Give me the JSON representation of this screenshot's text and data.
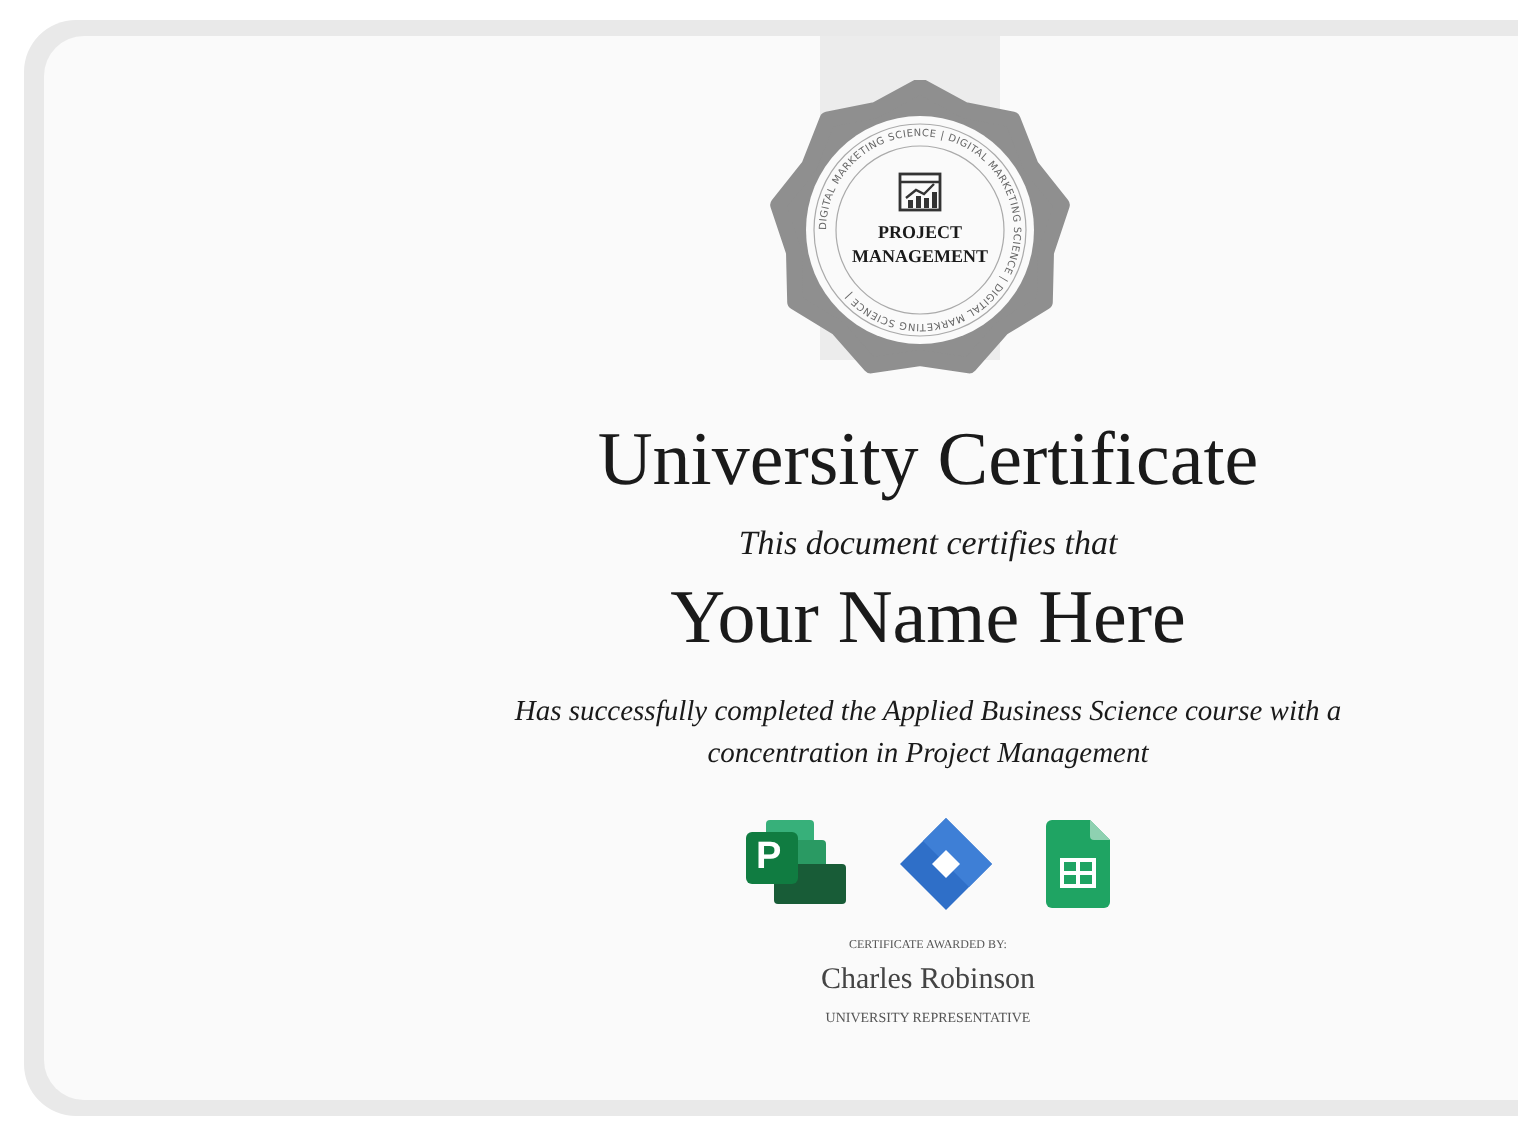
{
  "badge": {
    "ring_text": "DIGITAL MARKETING SCIENCE | DIGITAL MARKETING SCIENCE | DIGITAL MARKETING SCIENCE |",
    "title": "PROJECT MANAGEMENT"
  },
  "title": "University Certificate",
  "certifies": "This document certifies that",
  "recipient": "Your Name Here",
  "description": "Has successfully completed the Applied Business Science course with a concentration in Project Management",
  "tools": [
    {
      "kind": "project",
      "letter": "P"
    },
    {
      "kind": "diamond"
    },
    {
      "kind": "sheets"
    }
  ],
  "awarded_by_label": "CERTIFICATE AWARDED BY:",
  "signer": "Charles Robinson",
  "signer_role": "UNIVERSITY REPRESENTATIVE"
}
